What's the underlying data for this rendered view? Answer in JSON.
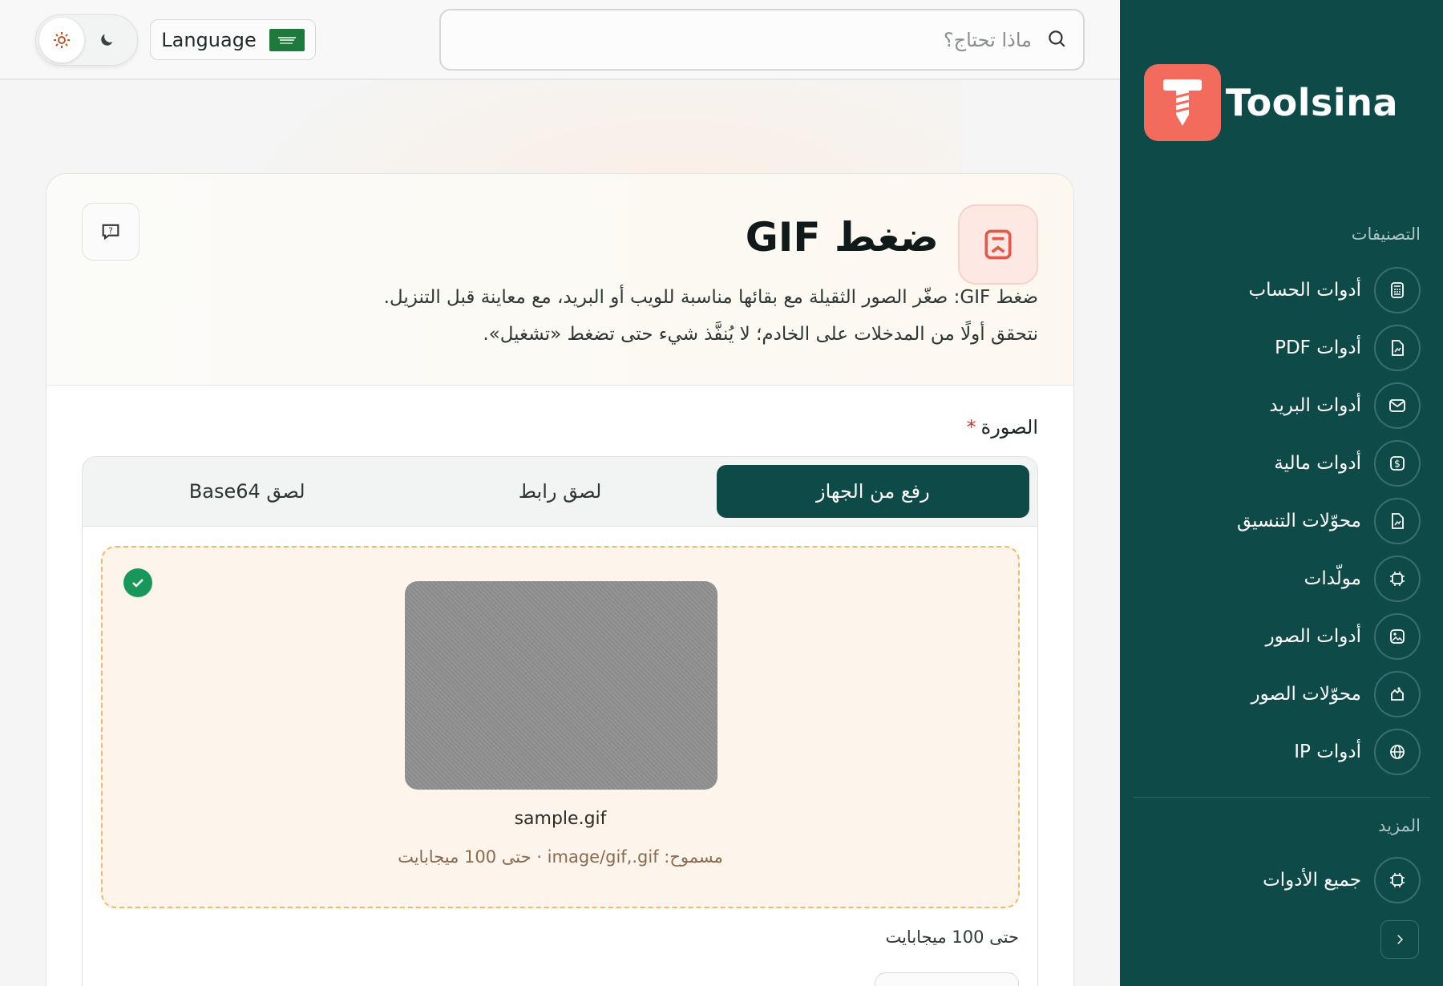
{
  "brand": {
    "name": "Toolsina",
    "accent": "#f26b5c",
    "sidebar_bg": "#0e4a48"
  },
  "topbar": {
    "search_placeholder": "ماذا تحتاج؟",
    "language_label": "Language",
    "theme": {
      "light_icon": "sun-icon",
      "dark_icon": "moon-icon",
      "selected": "light"
    }
  },
  "sidebar": {
    "categories_title": "التصنيفات",
    "items": [
      {
        "label": "أدوات الحساب",
        "icon": "calculator-icon"
      },
      {
        "label": "أدوات PDF",
        "icon": "pdf-file-icon"
      },
      {
        "label": "أدوات البريد",
        "icon": "mail-icon"
      },
      {
        "label": "أدوات مالية",
        "icon": "dollar-icon"
      },
      {
        "label": "محوّلات التنسيق",
        "icon": "convert-file-icon"
      },
      {
        "label": "مولّدات",
        "icon": "generator-icon"
      },
      {
        "label": "أدوات الصور",
        "icon": "image-icon"
      },
      {
        "label": "محوّلات الصور",
        "icon": "image-convert-icon"
      },
      {
        "label": "أدوات IP",
        "icon": "globe-icon"
      }
    ],
    "more_title": "المزيد",
    "more_items": [
      {
        "label": "جميع الأدوات",
        "icon": "all-tools-icon"
      }
    ]
  },
  "tool": {
    "title": "ضغط GIF",
    "description_line1": "ضغط GIF: صغّر الصور الثقيلة مع بقائها مناسبة للويب أو البريد، مع معاينة قبل التنزيل.",
    "description_line2": "نتحقق أولًا من المدخلات على الخادم؛ لا يُنفَّذ شيء حتى تضغط «تشغيل».",
    "field_label": "الصورة",
    "required_mark": "*",
    "tabs": [
      {
        "label": "رفع من الجهاز",
        "active": true
      },
      {
        "label": "لصق رابط",
        "active": false
      },
      {
        "label": "لصق Base64",
        "active": false
      }
    ],
    "upload": {
      "filename": "sample.gif",
      "allowed_text": "مسموح: image/gif,.gif · حتى 100 ميجابايت",
      "size_note": "حتى 100 ميجابايت"
    }
  }
}
